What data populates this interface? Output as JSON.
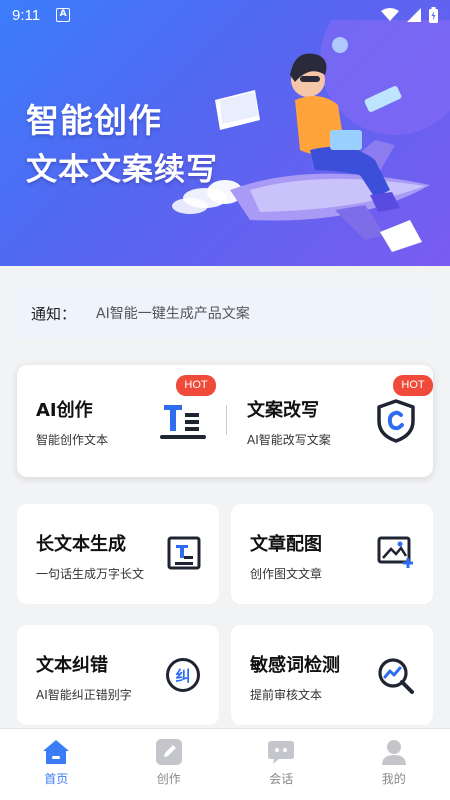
{
  "status": {
    "time": "9:11",
    "indicator": "A"
  },
  "banner": {
    "title_line1": "智能创作",
    "title_line2": "文本文案续写"
  },
  "notice": {
    "label": "通知：",
    "text": "AI智能一键生成产品文案"
  },
  "featured": [
    {
      "title": "AI创作",
      "subtitle": "智能创作文本",
      "badge": "HOT",
      "icon": "text-editor-icon"
    },
    {
      "title": "文案改写",
      "subtitle": "AI智能改写文案",
      "badge": "HOT",
      "icon": "shield-c-icon"
    }
  ],
  "tiles": [
    {
      "title": "长文本生成",
      "subtitle": "一句话生成万字长文",
      "icon": "long-text-icon"
    },
    {
      "title": "文章配图",
      "subtitle": "创作图文文章",
      "icon": "image-add-icon"
    },
    {
      "title": "文本纠错",
      "subtitle": "AI智能纠正错别字",
      "icon": "correction-icon"
    },
    {
      "title": "敏感词检测",
      "subtitle": "提前审核文本",
      "icon": "search-chart-icon"
    }
  ],
  "nav": [
    {
      "label": "首页",
      "icon": "home-icon",
      "active": true
    },
    {
      "label": "创作",
      "icon": "edit-icon",
      "active": false
    },
    {
      "label": "会话",
      "icon": "chat-icon",
      "active": false
    },
    {
      "label": "我的",
      "icon": "user-icon",
      "active": false
    }
  ],
  "colors": {
    "accent": "#3a7cf5",
    "hot": "#ef4a3a",
    "icon_dark": "#1f2433"
  }
}
